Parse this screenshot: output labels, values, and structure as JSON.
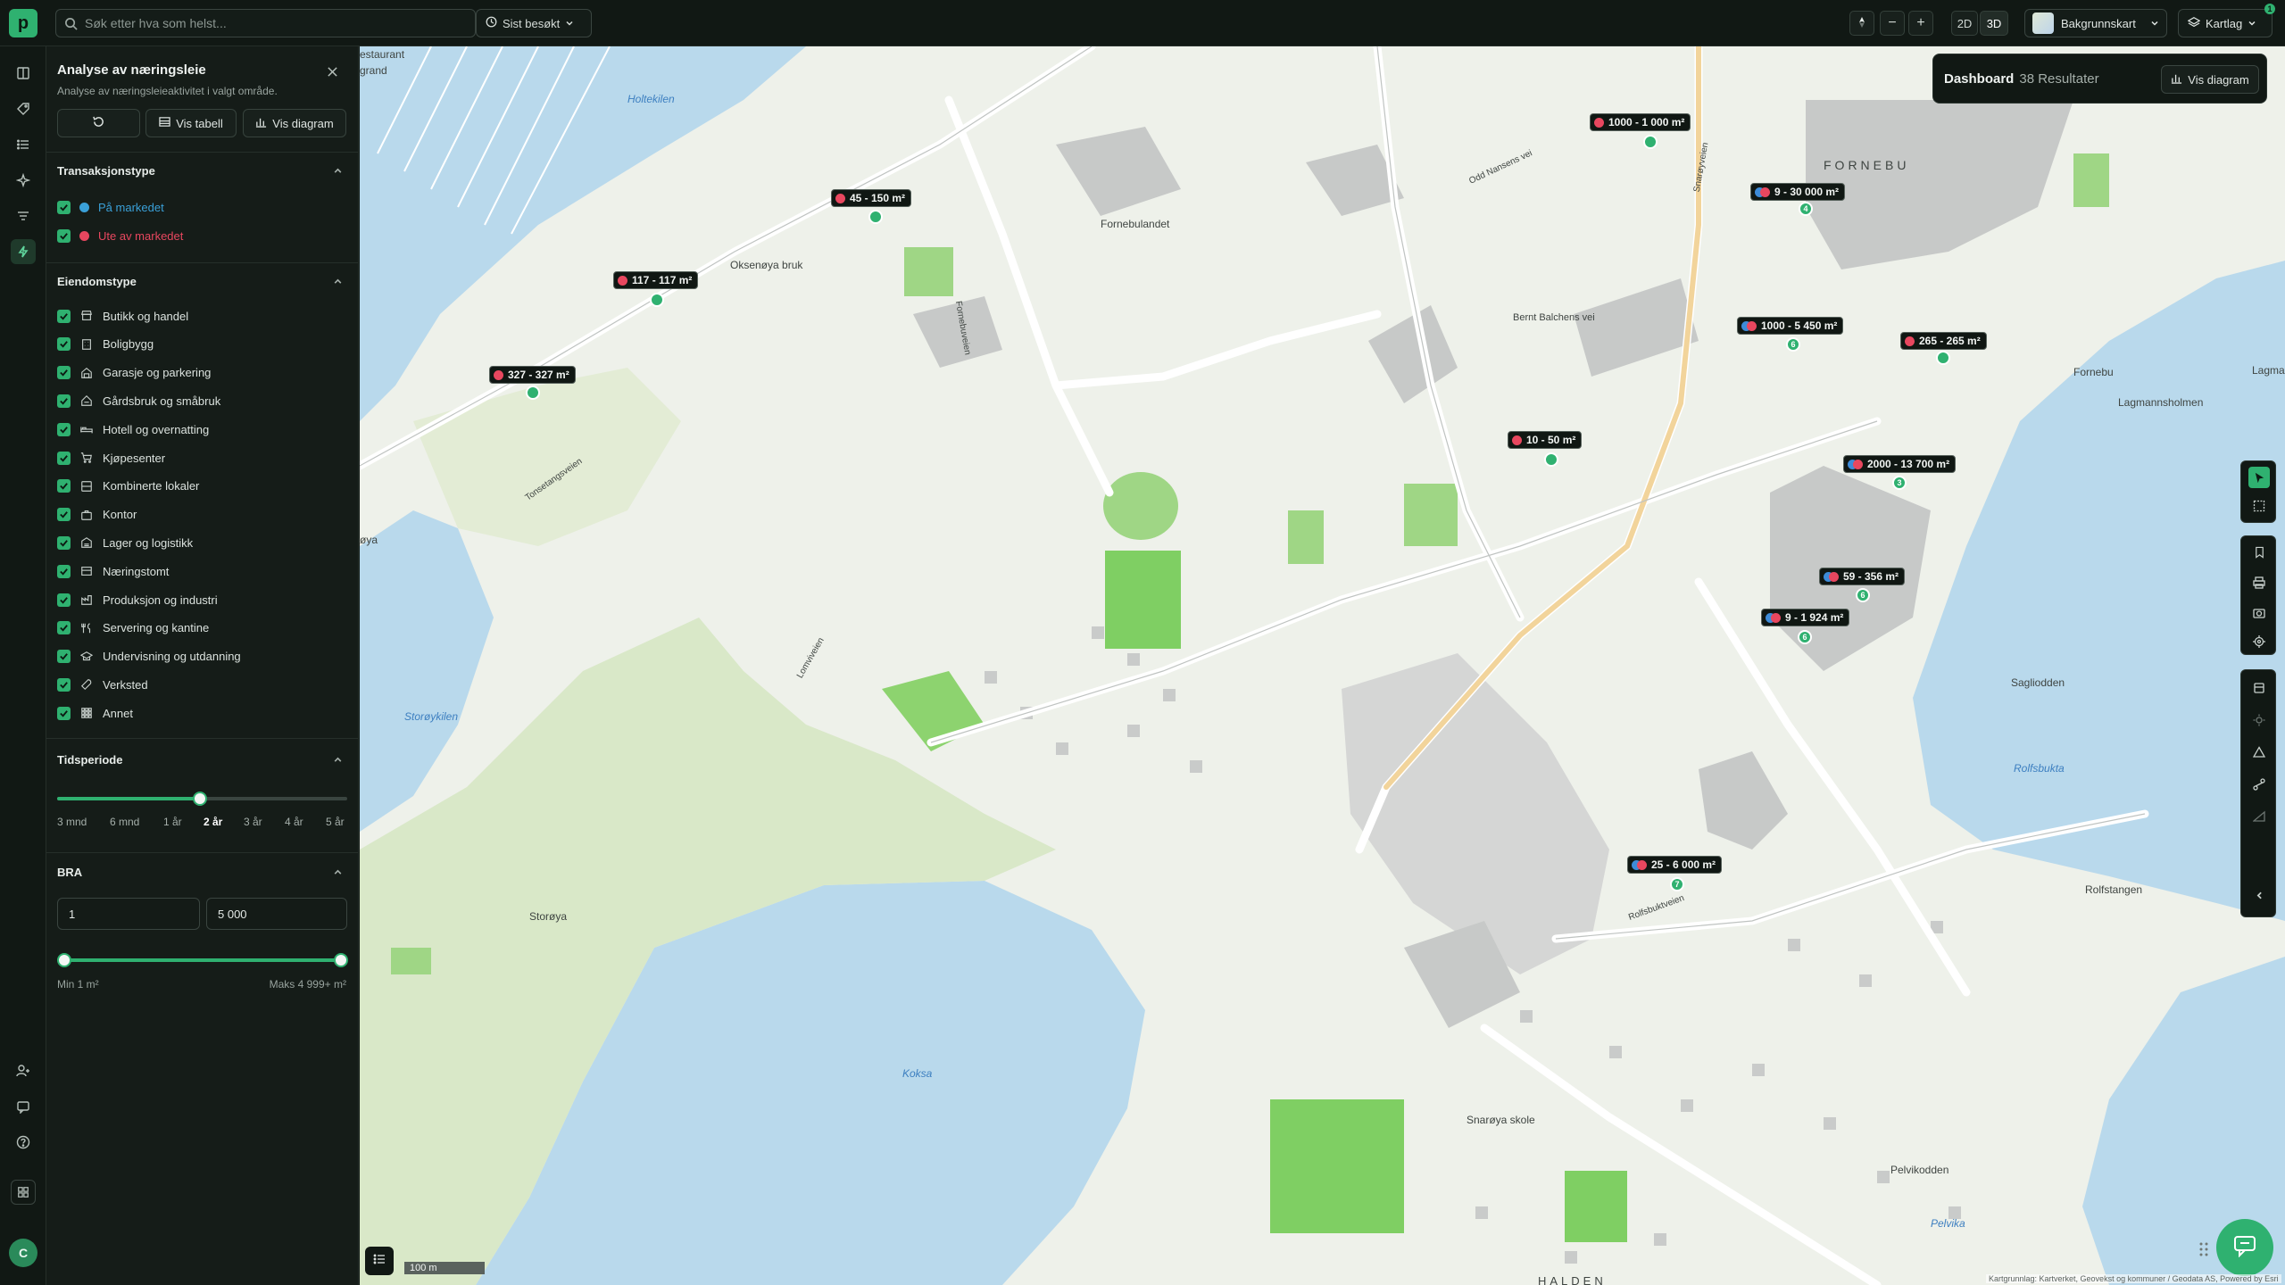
{
  "app": {
    "logo_letter": "p",
    "accent": "#2fb170",
    "notification_count": "1"
  },
  "search": {
    "placeholder": "Søk etter hva som helst..."
  },
  "recent": {
    "label": "Sist besøkt"
  },
  "map_controls": {
    "zoom_out": "−",
    "zoom_in": "+",
    "mode_2d": "2D",
    "mode_3d": "3D",
    "basemap_label": "Bakgrunnskart",
    "layers_label": "Kartlag"
  },
  "panel": {
    "title": "Analyse av næringsleie",
    "subtitle": "Analyse av næringsleieaktivitet i valgt område.",
    "btn_table": "Vis tabell",
    "btn_chart": "Vis diagram",
    "transaction": {
      "heading": "Transaksjonstype",
      "items": [
        {
          "label": "På markedet",
          "color": "#3aa0d8",
          "checked": true
        },
        {
          "label": "Ute av markedet",
          "color": "#e8475f",
          "checked": true
        }
      ]
    },
    "property": {
      "heading": "Eiendomstype",
      "items": [
        {
          "label": "Butikk og handel",
          "icon": "store-icon",
          "checked": true
        },
        {
          "label": "Boligbygg",
          "icon": "building-icon",
          "checked": true
        },
        {
          "label": "Garasje og parkering",
          "icon": "garage-icon",
          "checked": true
        },
        {
          "label": "Gårdsbruk og småbruk",
          "icon": "barn-icon",
          "checked": true
        },
        {
          "label": "Hotell og overnatting",
          "icon": "bed-icon",
          "checked": true
        },
        {
          "label": "Kjøpesenter",
          "icon": "cart-icon",
          "checked": true
        },
        {
          "label": "Kombinerte lokaler",
          "icon": "combined-icon",
          "checked": true
        },
        {
          "label": "Kontor",
          "icon": "briefcase-icon",
          "checked": true
        },
        {
          "label": "Lager og logistikk",
          "icon": "warehouse-icon",
          "checked": true
        },
        {
          "label": "Næringstomt",
          "icon": "plot-icon",
          "checked": true
        },
        {
          "label": "Produksjon og industri",
          "icon": "factory-icon",
          "checked": true
        },
        {
          "label": "Servering og kantine",
          "icon": "utensils-icon",
          "checked": true
        },
        {
          "label": "Undervisning og utdanning",
          "icon": "education-icon",
          "checked": true
        },
        {
          "label": "Verksted",
          "icon": "wrench-icon",
          "checked": true
        },
        {
          "label": "Annet",
          "icon": "grid-icon",
          "checked": true
        }
      ]
    },
    "period": {
      "heading": "Tidsperiode",
      "ticks": [
        "3 mnd",
        "6 mnd",
        "1 år",
        "2 år",
        "3 år",
        "4 år",
        "5 år"
      ],
      "selected": "2 år"
    },
    "bra": {
      "heading": "BRA",
      "min_value": "1",
      "max_value": "5 000",
      "min_label": "Min 1 m²",
      "max_label": "Maks 4 999+ m²"
    }
  },
  "dashboard": {
    "title": "Dashboard",
    "count": "38 Resultater",
    "button": "Vis diagram"
  },
  "pins": [
    {
      "label": "1000 - 1 000 m²",
      "dots": "red"
    },
    {
      "label": "45 - 150 m²",
      "dots": "red"
    },
    {
      "label": "9 - 30 000 m²",
      "dots": "both",
      "count": "4"
    },
    {
      "label": "117 - 117 m²",
      "dots": "red"
    },
    {
      "label": "1000 - 5 450 m²",
      "dots": "both",
      "count": "6"
    },
    {
      "label": "265 - 265 m²",
      "dots": "red"
    },
    {
      "label": "327 - 327 m²",
      "dots": "red"
    },
    {
      "label": "10 - 50 m²",
      "dots": "red"
    },
    {
      "label": "2000 - 13 700 m²",
      "dots": "both",
      "count": "3"
    },
    {
      "label": "59 - 356 m²",
      "dots": "both",
      "count": "6"
    },
    {
      "label": "9 - 1 924 m²",
      "dots": "both",
      "count": "6"
    },
    {
      "label": "25 - 6 000 m²",
      "dots": "both",
      "count": "7"
    }
  ],
  "places": {
    "holtekilen": "Holtekilen",
    "fornebu": "FORNEBU",
    "fornebulandet": "Fornebulandet",
    "oksenoya": "Oksenøya bruk",
    "bernt": "Bernt Balchens vei",
    "lagmannsholmen": "Lagmannsholmen",
    "storoykilen": "Storøykilen",
    "storoya": "Storøya",
    "koksa": "Koksa",
    "rolfsbukta": "Rolfsbukta",
    "saglisodden": "Sagliodden",
    "rolfstangen": "Rolfstangen",
    "pelvikodden": "Pelvikodden",
    "pelvika": "Pelvika",
    "snaroya": "Snarøya skole",
    "halden": "HALDEN",
    "fornebu_small": "Fornebu",
    "lagma": "Lagma",
    "oya": "øya",
    "grand": "grand",
    "restaurant": "estaurant",
    "fornebuveien": "Fornebuveien",
    "snaroyveien": "Snarøyveien",
    "rolfsbuktveien": "Rolfsbuktveien",
    "lomviveien": "Lomviveien",
    "tonsetveien": "Tonsetangsveien",
    "oddnansen": "Odd Nansens vei"
  },
  "scale": {
    "label": "100 m"
  },
  "attribution": {
    "text": "Kartgrunnlag: Kartverket, Geovekst og kommuner / Geodata AS, Powered by Esri"
  }
}
